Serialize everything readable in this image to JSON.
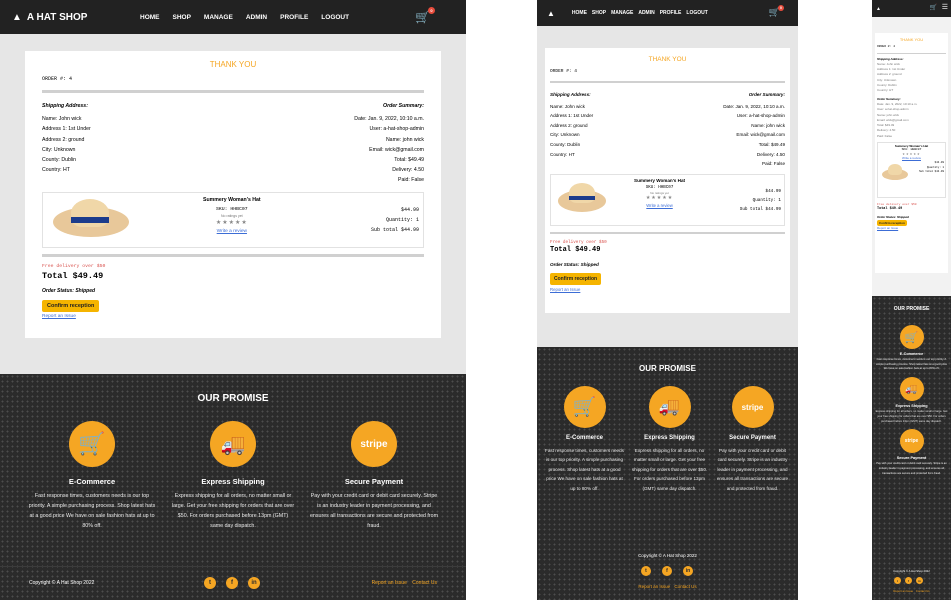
{
  "brand": "A HAT SHOP",
  "nav": [
    "HOME",
    "SHOP",
    "MANAGE",
    "ADMIN",
    "PROFILE",
    "LOGOUT"
  ],
  "cart_count": "0",
  "thanks": "THANK YOU",
  "order_no": "ORDER #: 4",
  "shipping_title": "Shipping Address:",
  "summary_title": "Order Summary:",
  "shipping": [
    "Name: John wick",
    "Address 1: 1st Under",
    "Address 2: ground",
    "City: Unknown",
    "County: Dublin",
    "Country: HT"
  ],
  "summary": [
    "Date: Jan. 9, 2022, 10:10 a.m.",
    "User: a-hat-shop-admin",
    "Name: john wick",
    "Email: wick@gmail.com",
    "Total: $49.49",
    "Delivery: 4.50",
    "Paid: False"
  ],
  "item": {
    "name": "Summery Woman's Hat",
    "sku": "SKU: HHBC07",
    "note": "No ratings yet",
    "stars": "★★★★★",
    "review": "Write a review",
    "price": "$44.99",
    "qty": "Quantity: 1",
    "subtotal": "Sub total $44.99"
  },
  "free_delivery": "Free delivery over $50",
  "total": "Total $49.49",
  "status": "Order Status: Shipped",
  "confirm": "Confirm reception",
  "report": "Report an Issue",
  "promise_title": "OUR PROMISE",
  "promises": [
    {
      "icon": "cart-icon",
      "title": "E-Commerce",
      "text": "Fast response times, customers needs is our top priority. A simple purchasing process. Shop latest hats at a good price We have on sale fashion hats at up to 80% off."
    },
    {
      "icon": "truck-icon",
      "title": "Express Shipping",
      "text": "Express shipping for all orders, no matter small or large. Get your free shipping for orders that are over $50. For orders purchased before 13pm (GMT) same day dispatch."
    },
    {
      "icon": "stripe-icon",
      "title": "Secure Payment",
      "text": "Pay with your credit card or debit card securely. Stripe is an industry leader in payment processing, and ensures all transactions are secure and protected from fraud."
    }
  ],
  "stripe_label": "stripe",
  "copyright": "Copyright © A Hat Shop 2022",
  "footer_links": [
    "Report an Issue",
    "Contact Us"
  ],
  "social": [
    "twitter-icon",
    "facebook-icon",
    "linkedin-icon"
  ],
  "colors": {
    "accent": "#f5a623",
    "nav": "#222222",
    "footer": "#2b2b2b",
    "button": "#f5b400"
  }
}
